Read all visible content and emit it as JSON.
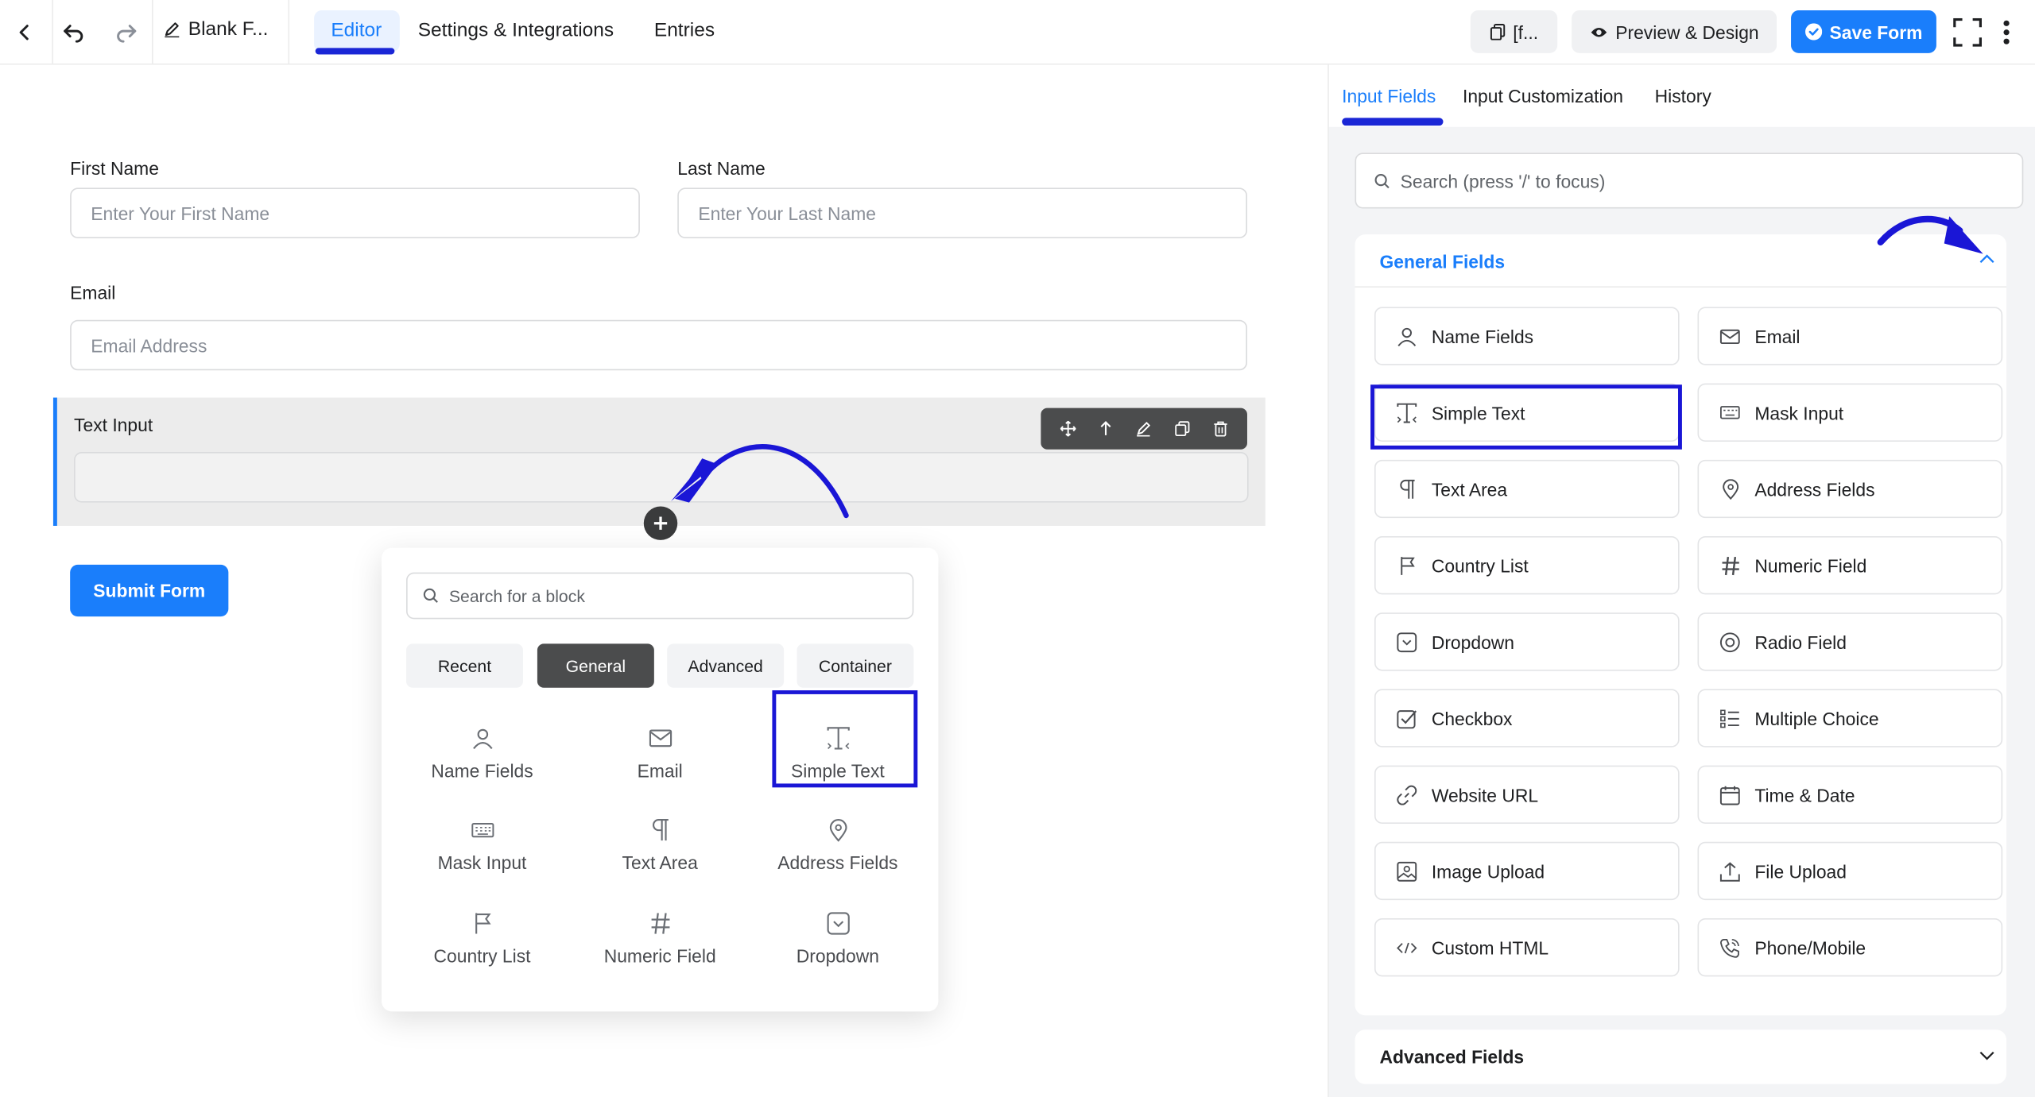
{
  "topbar": {
    "form_title": "Blank F...",
    "tabs": [
      "Editor",
      "Settings & Integrations",
      "Entries"
    ],
    "shortcode_label": "[f...",
    "preview_label": "Preview & Design",
    "save_label": "Save Form"
  },
  "form": {
    "first_name_label": "First Name",
    "first_name_placeholder": "Enter Your First Name",
    "last_name_label": "Last Name",
    "last_name_placeholder": "Enter Your Last Name",
    "email_label": "Email",
    "email_placeholder": "Email Address",
    "text_input_label": "Text Input",
    "submit_label": "Submit Form"
  },
  "picker": {
    "search_placeholder": "Search for a block",
    "tabs": [
      "Recent",
      "General",
      "Advanced",
      "Container"
    ],
    "items": [
      "Name Fields",
      "Email",
      "Simple Text",
      "Mask Input",
      "Text Area",
      "Address Fields",
      "Country List",
      "Numeric Field",
      "Dropdown"
    ]
  },
  "panel": {
    "tabs": [
      "Input Fields",
      "Input Customization",
      "History"
    ],
    "search_placeholder": "Search (press '/' to focus)",
    "general_title": "General Fields",
    "fields": [
      "Name Fields",
      "Email",
      "Simple Text",
      "Mask Input",
      "Text Area",
      "Address Fields",
      "Country List",
      "Numeric Field",
      "Dropdown",
      "Radio Field",
      "Checkbox",
      "Multiple Choice",
      "Website URL",
      "Time & Date",
      "Image Upload",
      "File Upload",
      "Custom HTML",
      "Phone/Mobile"
    ],
    "advanced_title": "Advanced Fields"
  },
  "colors": {
    "accent": "#1a7efb",
    "annotation": "#1a16d6"
  }
}
